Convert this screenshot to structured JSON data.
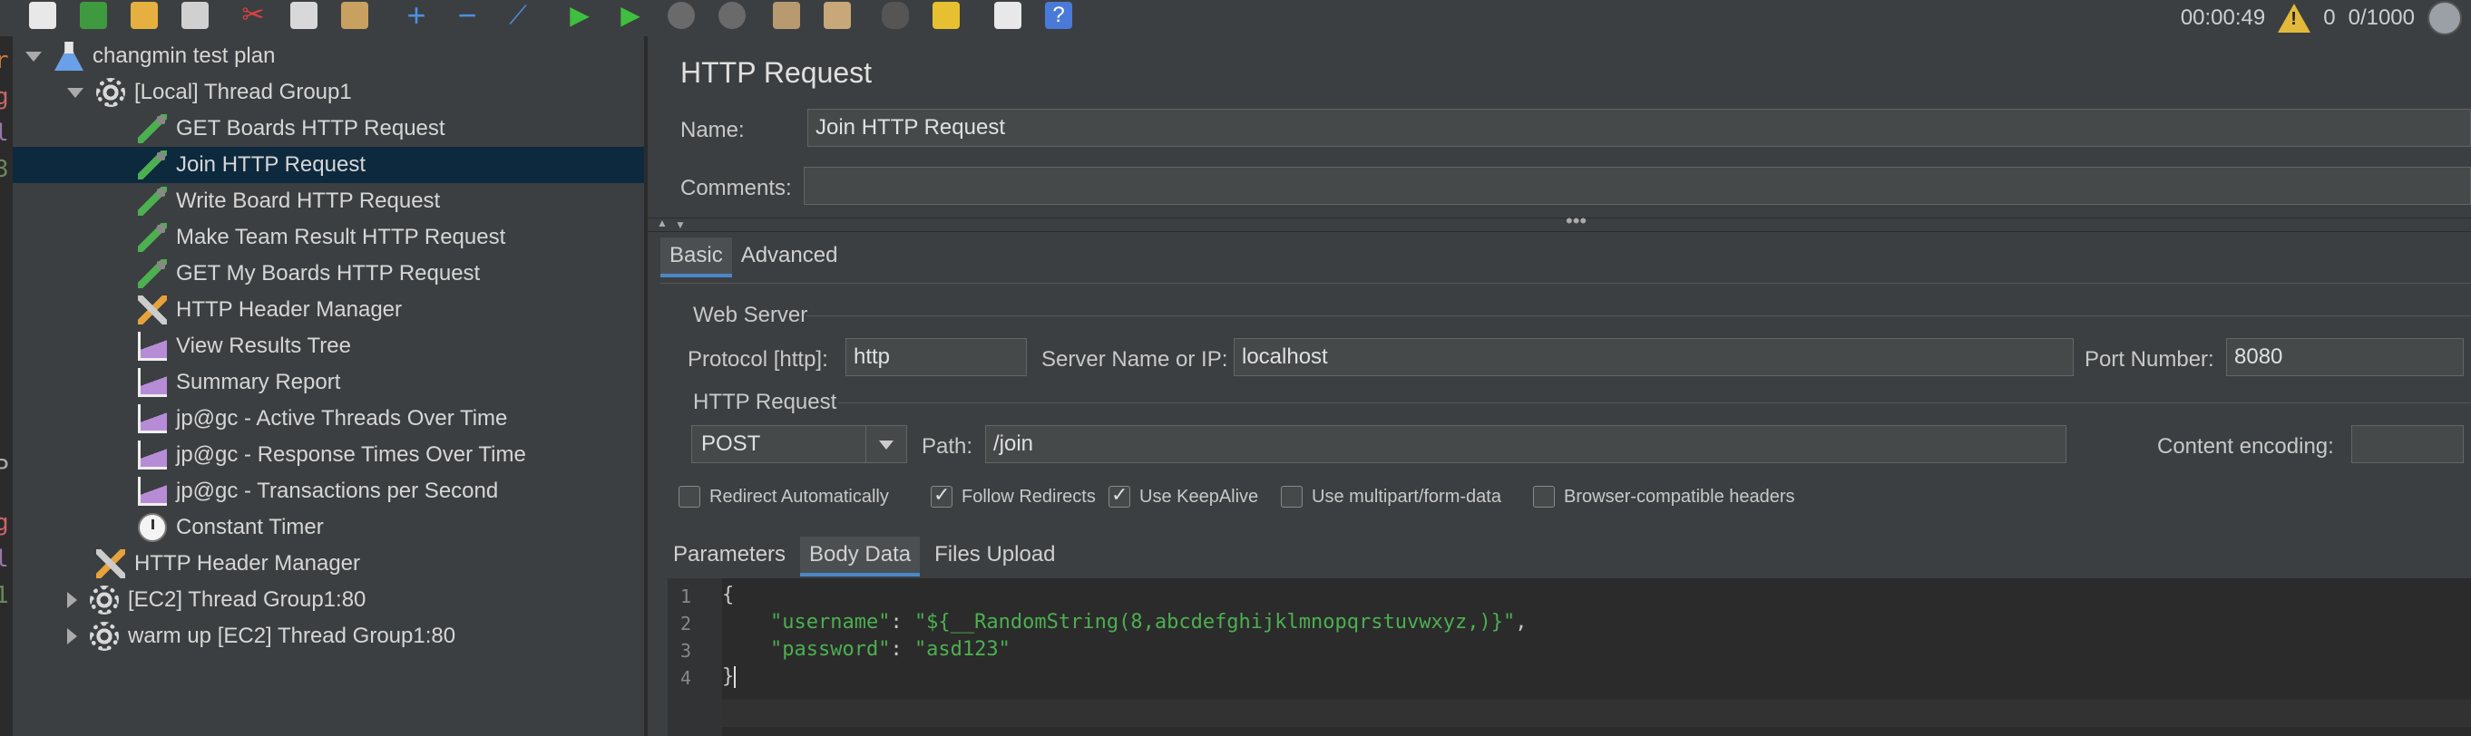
{
  "status": {
    "elapsed": "00:00:49",
    "warnings": "0",
    "threads": "0/1000"
  },
  "tree": [
    {
      "label": "changmin test plan",
      "icon": "flask-icon",
      "level": 0,
      "expanded": true
    },
    {
      "label": "[Local] Thread Group1",
      "icon": "gear-icon",
      "level": 1,
      "expanded": true
    },
    {
      "label": "GET Boards HTTP Request",
      "icon": "pipette-icon",
      "level": 2
    },
    {
      "label": "Join HTTP Request",
      "icon": "pipette-icon",
      "level": 2,
      "selected": true
    },
    {
      "label": "Write Board HTTP Request",
      "icon": "pipette-icon",
      "level": 2
    },
    {
      "label": "Make Team Result  HTTP Request",
      "icon": "pipette-icon",
      "level": 2
    },
    {
      "label": "GET My Boards HTTP Request",
      "icon": "pipette-icon",
      "level": 2
    },
    {
      "label": "HTTP Header Manager",
      "icon": "tools-icon",
      "level": 2
    },
    {
      "label": "View Results Tree",
      "icon": "chart-icon",
      "level": 2
    },
    {
      "label": "Summary Report",
      "icon": "chart-icon",
      "level": 2
    },
    {
      "label": "jp@gc - Active Threads Over Time",
      "icon": "chart-icon",
      "level": 2
    },
    {
      "label": "jp@gc - Response Times Over Time",
      "icon": "chart-icon",
      "level": 2
    },
    {
      "label": "jp@gc - Transactions per Second",
      "icon": "chart-icon",
      "level": 2
    },
    {
      "label": "Constant Timer",
      "icon": "timer-icon",
      "level": 2
    },
    {
      "label": "HTTP Header Manager",
      "icon": "tools-icon",
      "level": 1
    },
    {
      "label": "[EC2] Thread Group1:80",
      "icon": "gear-icon",
      "level": 1,
      "expanded": false
    },
    {
      "label": "warm up [EC2] Thread Group1:80",
      "icon": "gear-icon",
      "level": 1,
      "expanded": false
    }
  ],
  "panel": {
    "title": "HTTP Request",
    "name_label": "Name:",
    "name_value": "Join HTTP Request",
    "comments_label": "Comments:",
    "comments_value": "",
    "tabs": [
      "Basic",
      "Advanced"
    ],
    "web_server_label": "Web Server",
    "protocol_label": "Protocol [http]:",
    "protocol_value": "http",
    "server_label": "Server Name or IP:",
    "server_value": "localhost",
    "port_label": "Port Number:",
    "port_value": "8080",
    "http_request_label": "HTTP Request",
    "method": "POST",
    "path_label": "Path:",
    "path_value": "/join",
    "encoding_label": "Content encoding:",
    "encoding_value": "",
    "checkboxes": [
      {
        "label": "Redirect Automatically",
        "checked": false
      },
      {
        "label": "Follow Redirects",
        "checked": true
      },
      {
        "label": "Use KeepAlive",
        "checked": true
      },
      {
        "label": "Use multipart/form-data",
        "checked": false
      },
      {
        "label": "Browser-compatible headers",
        "checked": false
      }
    ],
    "subtabs": [
      "Parameters",
      "Body Data",
      "Files Upload"
    ],
    "body_lines": [
      {
        "n": "1",
        "text": "{"
      },
      {
        "n": "2",
        "key": "\"username\"",
        "sep": ": ",
        "val": "\"${__RandomString(8,abcdefghijklmnopqrstuvwxyz,)}\"",
        "end": ","
      },
      {
        "n": "3",
        "key": "\"password\"",
        "sep": ": ",
        "val": "\"asd123\"",
        "end": ""
      },
      {
        "n": "4",
        "text": "}"
      }
    ]
  },
  "colors": {
    "bg": "#3c3f41",
    "selected": "#0d293e",
    "accent": "#4a88c7",
    "string": "#4caf50"
  }
}
